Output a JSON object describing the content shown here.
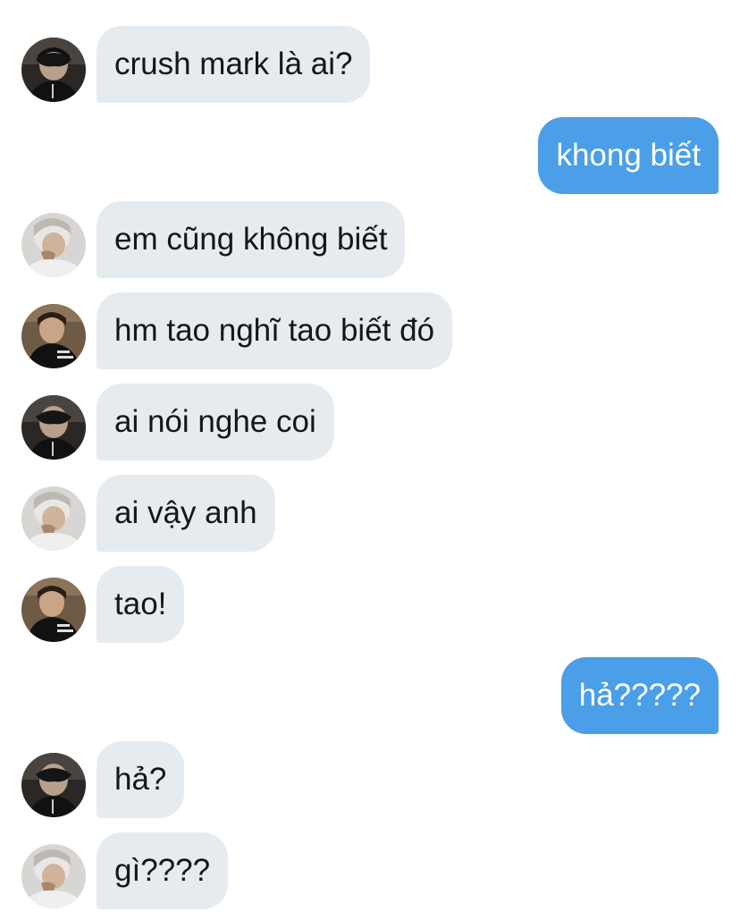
{
  "messages": [
    {
      "side": "in",
      "sender": "dark-avatar",
      "text": "crush mark là ai?"
    },
    {
      "side": "out",
      "text": "khong biết"
    },
    {
      "side": "in",
      "sender": "light-avatar",
      "text": "em cũng không biết"
    },
    {
      "side": "in",
      "sender": "sweater-avatar",
      "text": "hm tao nghĩ tao biết đó"
    },
    {
      "side": "in",
      "sender": "dark-avatar",
      "text": "ai nói nghe coi"
    },
    {
      "side": "in",
      "sender": "light-avatar",
      "text": "ai vậy anh"
    },
    {
      "side": "in",
      "sender": "sweater-avatar",
      "text": "tao!"
    },
    {
      "side": "out",
      "text": "hả?????"
    },
    {
      "side": "in",
      "sender": "dark-avatar",
      "text": "hả?"
    },
    {
      "side": "in",
      "sender": "light-avatar",
      "text": "gì????"
    }
  ],
  "colors": {
    "incoming_bubble": "#e6ebef",
    "outgoing_bubble": "#4a9fe8",
    "incoming_text": "#14171a",
    "outgoing_text": "#ffffff"
  }
}
